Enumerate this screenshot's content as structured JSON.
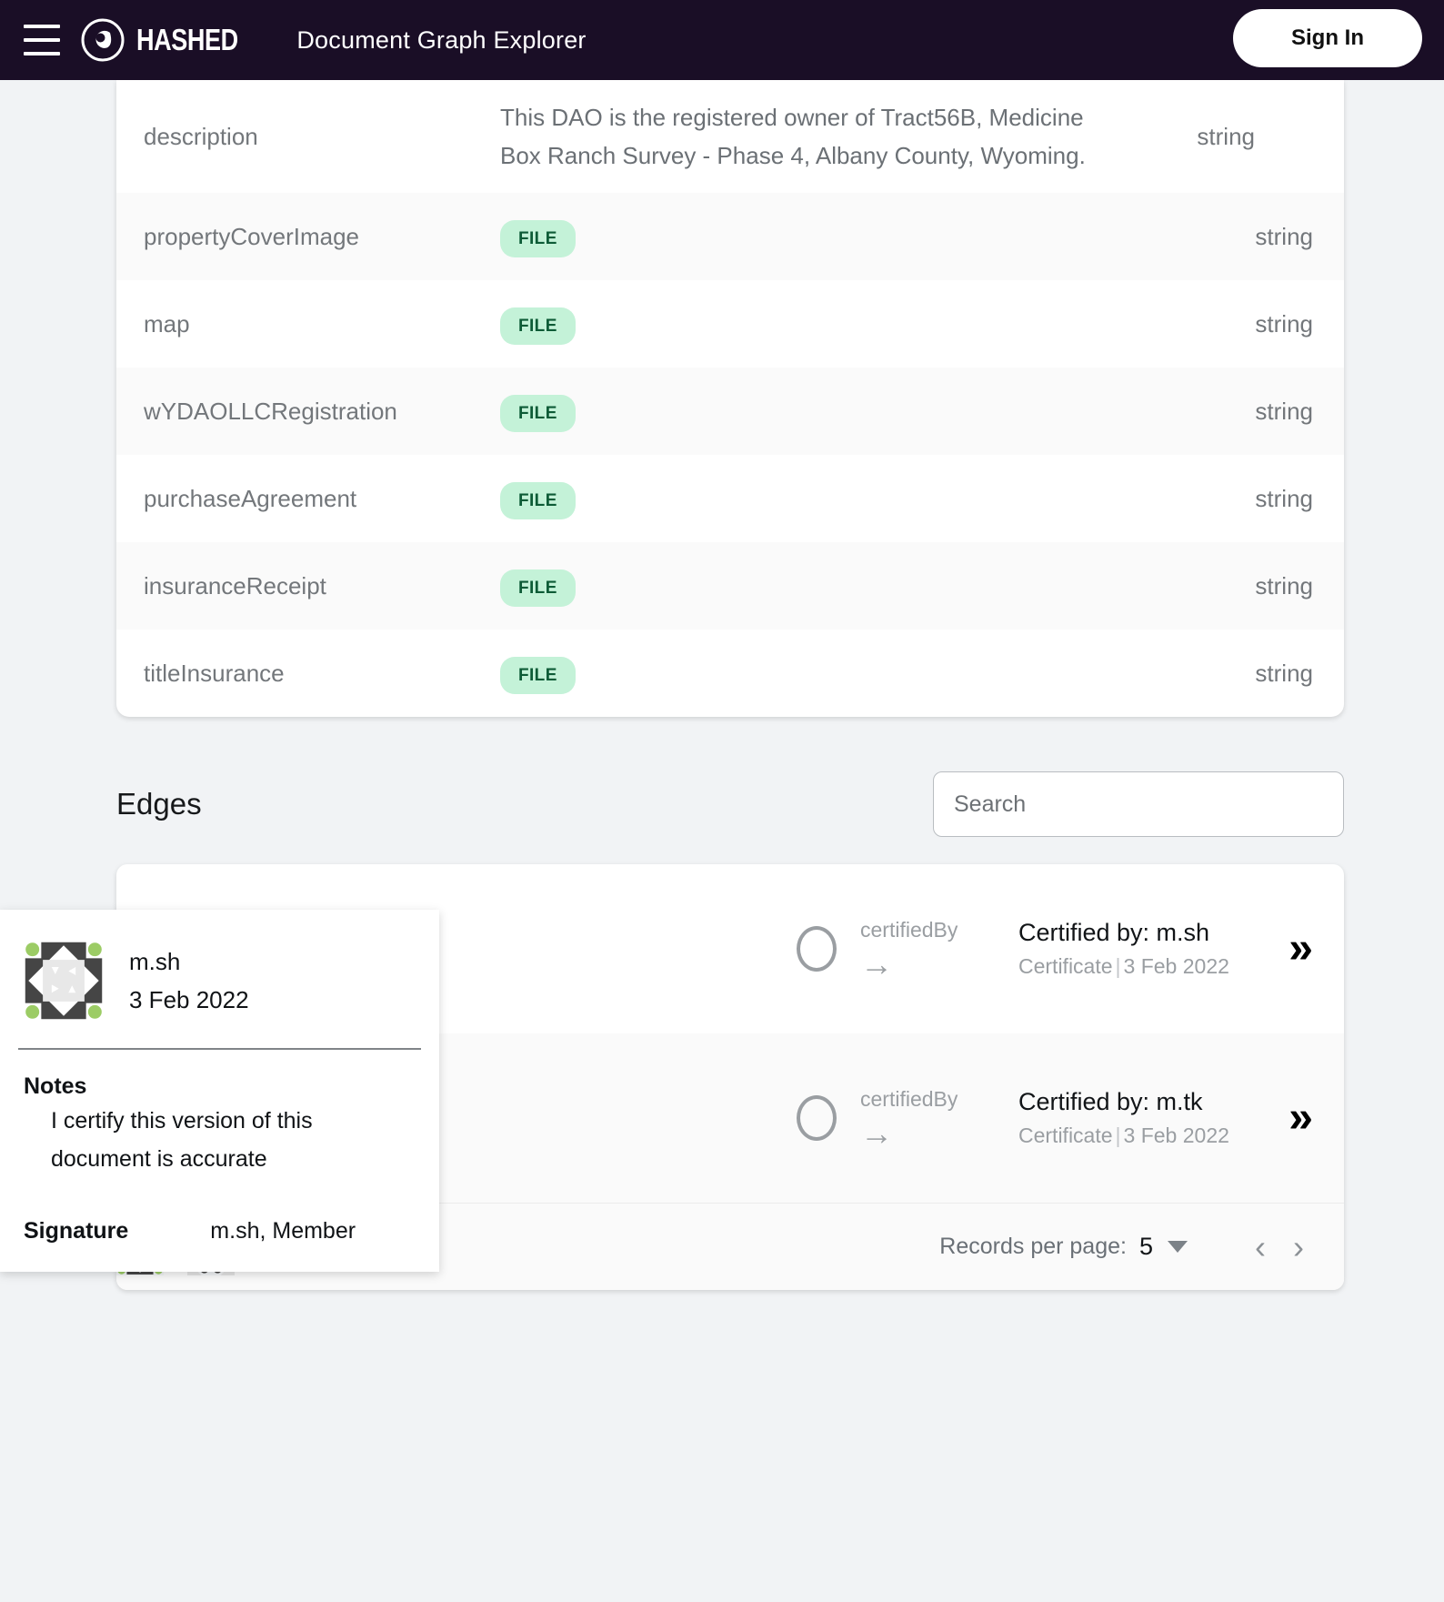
{
  "header": {
    "menu_icon": "hamburger-menu-icon",
    "logo_icon": "hashed-logo-icon",
    "brand": "HASHED",
    "title": "Document Graph Explorer",
    "sign_in_label": "Sign In"
  },
  "properties": {
    "type_label": "string",
    "file_badge": "FILE",
    "rows": [
      {
        "key": "description",
        "value": "This DAO is the registered owner of Tract56B, Medicine Box Ranch Survey - Phase 4, Albany County, Wyoming.",
        "kind": "text",
        "type": "string"
      },
      {
        "key": "propertyCoverImage",
        "value": "FILE",
        "kind": "file",
        "type": "string"
      },
      {
        "key": "map",
        "value": "FILE",
        "kind": "file",
        "type": "string"
      },
      {
        "key": "wYDAOLLCRegistration",
        "value": "FILE",
        "kind": "file",
        "type": "string"
      },
      {
        "key": "purchaseAgreement",
        "value": "FILE",
        "kind": "file",
        "type": "string"
      },
      {
        "key": "insuranceReceipt",
        "value": "FILE",
        "kind": "file",
        "type": "string"
      },
      {
        "key": "titleInsurance",
        "value": "FILE",
        "kind": "file",
        "type": "string"
      }
    ]
  },
  "edges": {
    "title": "Edges",
    "search_placeholder": "Search",
    "search_value": "",
    "rows": [
      {
        "relation": "certifiedBy",
        "arrow": "→",
        "target_title": "Certified by: m.sh",
        "target_kind": "Certificate",
        "target_date": "3 Feb 2022",
        "expand_icon": "double-chevron-right-icon"
      },
      {
        "relation": "certifiedBy",
        "arrow": "→",
        "target_title": "Certified by: m.tk",
        "target_kind": "Certificate",
        "target_date": "3 Feb 2022",
        "expand_icon": "double-chevron-right-icon"
      }
    ],
    "pagination": {
      "records_per_page_label": "Records per page:",
      "records_per_page_value": "5",
      "prev_icon": "chevron-left-icon",
      "next_icon": "chevron-right-icon"
    }
  },
  "tooltip": {
    "avatar_icon": "identicon-avatar",
    "name": "m.sh",
    "date": "3 Feb 2022",
    "notes_label": "Notes",
    "notes_text": "I certify this version of this document is accurate",
    "signature_label": "Signature",
    "signature_value": "m.sh, Member"
  },
  "bottom_icons": [
    {
      "icon": "identicon-green-diamond"
    },
    {
      "icon": "identicon-orange-pinwheel"
    }
  ],
  "colors": {
    "topbar_bg": "#1a0e26",
    "page_bg": "#f1f3f5",
    "file_badge_bg": "#c4f2d8",
    "file_badge_text": "#0d5b36",
    "muted_text": "#73777b",
    "identicon_green": "#9ccc65",
    "identicon_dark": "#454545",
    "identicon_orange": "#d79a5b"
  }
}
